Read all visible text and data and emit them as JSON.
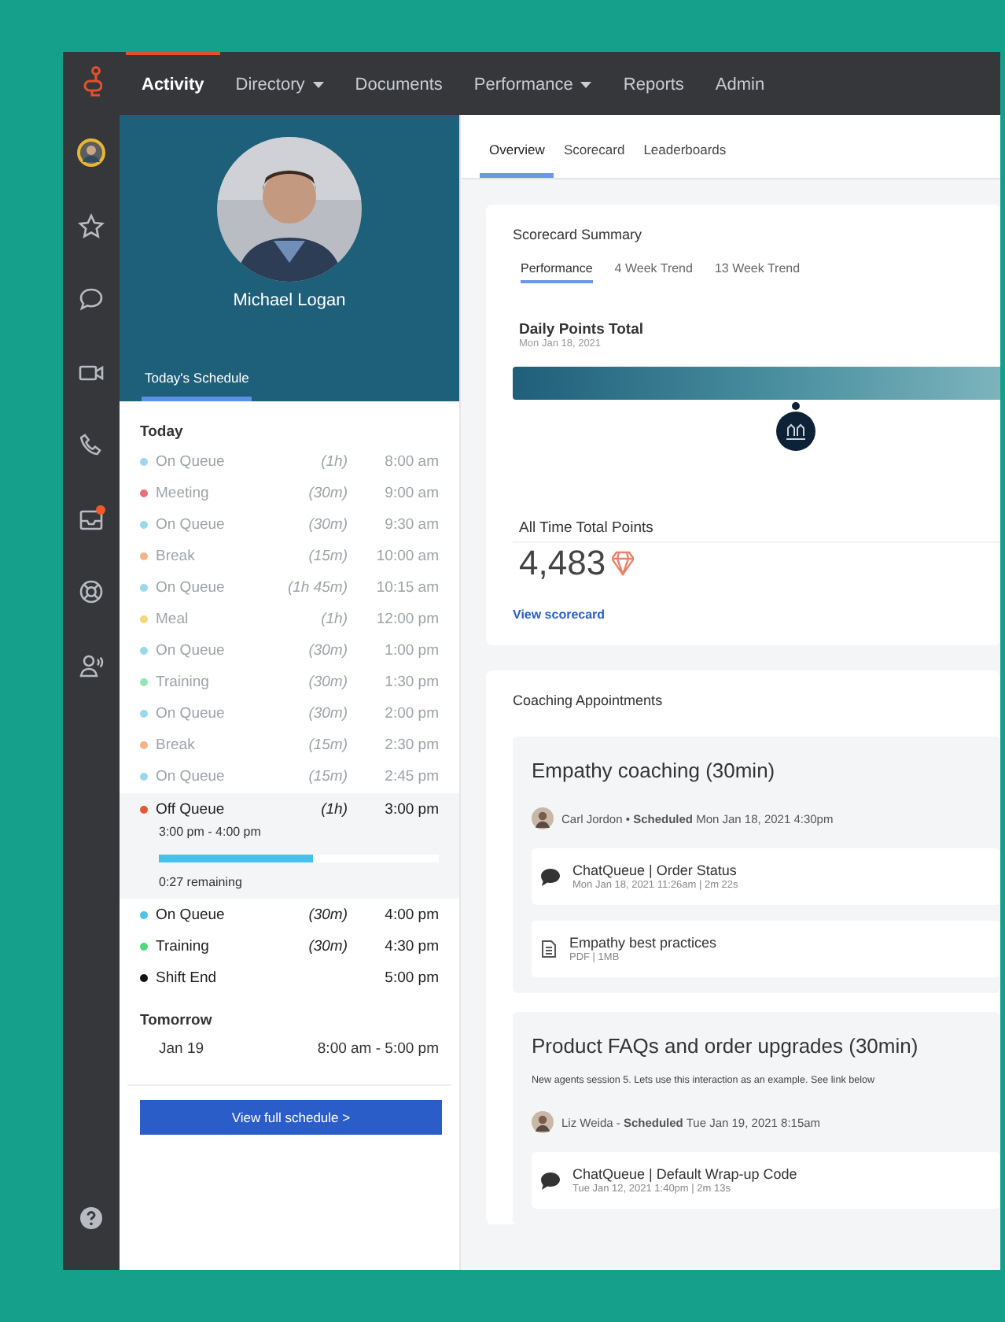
{
  "nav": {
    "items": [
      {
        "label": "Activity",
        "selected": true,
        "dropdown": false
      },
      {
        "label": "Directory",
        "selected": false,
        "dropdown": true
      },
      {
        "label": "Documents",
        "selected": false,
        "dropdown": false
      },
      {
        "label": "Performance",
        "selected": false,
        "dropdown": true
      },
      {
        "label": "Reports",
        "selected": false,
        "dropdown": false
      },
      {
        "label": "Admin",
        "selected": false,
        "dropdown": false
      }
    ]
  },
  "rail": {
    "items": [
      {
        "kind": "avatar",
        "badge": false
      },
      {
        "kind": "star",
        "badge": false
      },
      {
        "kind": "chat",
        "badge": false
      },
      {
        "kind": "video",
        "badge": false
      },
      {
        "kind": "phone",
        "badge": false
      },
      {
        "kind": "inbox",
        "badge": true
      },
      {
        "kind": "lifebuoy",
        "badge": false
      },
      {
        "kind": "agent",
        "badge": false
      }
    ]
  },
  "profile": {
    "name": "Michael Logan",
    "tab": "Today's Schedule"
  },
  "schedule": {
    "today_heading": "Today",
    "rows": [
      {
        "kind": "item",
        "activity": "On Queue",
        "duration": "(1h)",
        "time": "8:00 am",
        "color": "#9ad8ee",
        "past": true
      },
      {
        "kind": "item",
        "activity": "Meeting",
        "duration": "(30m)",
        "time": "9:00 am",
        "color": "#e8707e",
        "past": true
      },
      {
        "kind": "item",
        "activity": "On Queue",
        "duration": "(30m)",
        "time": "9:30 am",
        "color": "#9ad8ee",
        "past": true
      },
      {
        "kind": "item",
        "activity": "Break",
        "duration": "(15m)",
        "time": "10:00 am",
        "color": "#f2b48a",
        "past": true
      },
      {
        "kind": "item",
        "activity": "On Queue",
        "duration": "(1h 45m)",
        "time": "10:15 am",
        "color": "#9ad8ee",
        "past": true
      },
      {
        "kind": "item",
        "activity": "Meal",
        "duration": "(1h)",
        "time": "12:00 pm",
        "color": "#f5d67a",
        "past": true
      },
      {
        "kind": "item",
        "activity": "On Queue",
        "duration": "(30m)",
        "time": "1:00 pm",
        "color": "#9ad8ee",
        "past": true
      },
      {
        "kind": "item",
        "activity": "Training",
        "duration": "(30m)",
        "time": "1:30 pm",
        "color": "#92e6b4",
        "past": true
      },
      {
        "kind": "item",
        "activity": "On Queue",
        "duration": "(30m)",
        "time": "2:00 pm",
        "color": "#9ad8ee",
        "past": true
      },
      {
        "kind": "item",
        "activity": "Break",
        "duration": "(15m)",
        "time": "2:30 pm",
        "color": "#f2b48a",
        "past": true
      },
      {
        "kind": "item",
        "activity": "On Queue",
        "duration": "(15m)",
        "time": "2:45 pm",
        "color": "#9ad8ee",
        "past": true
      },
      {
        "kind": "current",
        "activity": "Off Queue",
        "duration": "(1h)",
        "time": "3:00 pm",
        "color": "#e0593b",
        "past": false,
        "range": "3:00 pm - 4:00 pm",
        "level": 0.55,
        "remaining": "0:27 remaining"
      },
      {
        "kind": "item",
        "activity": "On Queue",
        "duration": "(30m)",
        "time": "4:00 pm",
        "color": "#4fc3ee",
        "past": false
      },
      {
        "kind": "item",
        "activity": "Training",
        "duration": "(30m)",
        "time": "4:30 pm",
        "color": "#4ed77c",
        "past": false
      },
      {
        "kind": "item",
        "activity": "Shift End",
        "time": "5:00 pm",
        "color": "#111111",
        "past": false
      }
    ],
    "tomorrow_heading": "Tomorrow",
    "tomorrow": {
      "date": "Jan 19",
      "hours": "8:00 am - 5:00 pm"
    },
    "button": "View full schedule >"
  },
  "tabs": [
    {
      "label": "Overview",
      "selected": true
    },
    {
      "label": "Scorecard",
      "selected": false
    },
    {
      "label": "Leaderboards",
      "selected": false
    }
  ],
  "scorecard": {
    "title": "Scorecard Summary",
    "tabs": [
      {
        "label": "Performance",
        "selected": true
      },
      {
        "label": "4 Week Trend",
        "selected": false
      },
      {
        "label": "13 Week Trend",
        "selected": false
      }
    ],
    "daily_title": "Daily Points Total",
    "daily_date": "Mon Jan 18, 2021",
    "level": 0.58,
    "all_time_title": "All Time Total Points",
    "all_time_value": "4,483",
    "link": "View scorecard"
  },
  "coaching": {
    "title": "Coaching Appointments",
    "appointments": [
      {
        "title": "Empathy coaching (30min)",
        "person": "Carl Jordon",
        "scheduled": "• **Scheduled** Mon Jan 18, 2021 4:30pm",
        "attachments": [
          {
            "kind": "chat",
            "title": "ChatQueue | Order Status",
            "meta": "Mon Jan 18, 2021 11:26am | 2m 22s"
          },
          {
            "kind": "document",
            "title": "Empathy best practices",
            "meta": "PDF | 1MB"
          }
        ]
      },
      {
        "title": "Product FAQs and order upgrades (30min)",
        "description": "New agents session 5. Lets use this interaction as an example. See link below",
        "person": "Liz Weida",
        "scheduled": "- **Scheduled** Tue Jan 19, 2021 8:15am",
        "attachments": [
          {
            "kind": "chat",
            "title": "ChatQueue | Default Wrap-up Code",
            "meta": "Tue Jan 12, 2021 1:40pm | 2m 13s"
          }
        ]
      }
    ]
  }
}
